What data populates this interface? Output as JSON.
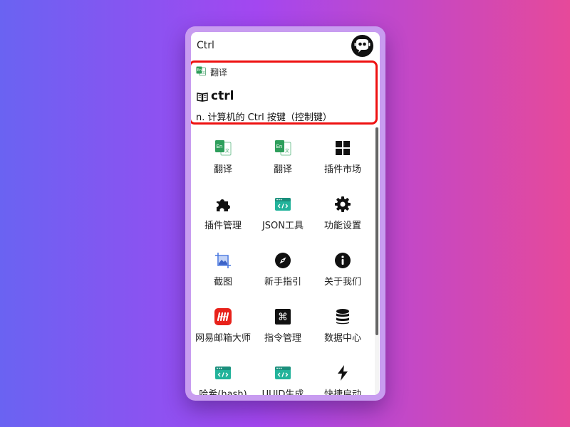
{
  "search": {
    "value": "Ctrl"
  },
  "result": {
    "plugin_label": "翻译",
    "word": "ctrl",
    "definition": "n. 计算机的 Ctrl 按键（控制键）"
  },
  "apps": [
    {
      "label": "翻译",
      "icon": "translate-icon"
    },
    {
      "label": "翻译",
      "icon": "translate-icon"
    },
    {
      "label": "插件市场",
      "icon": "windows-grid-icon"
    },
    {
      "label": "插件管理",
      "icon": "puzzle-icon"
    },
    {
      "label": "JSON工具",
      "icon": "code-window-icon"
    },
    {
      "label": "功能设置",
      "icon": "gear-icon"
    },
    {
      "label": "截图",
      "icon": "screenshot-icon"
    },
    {
      "label": "新手指引",
      "icon": "compass-icon"
    },
    {
      "label": "关于我们",
      "icon": "info-icon"
    },
    {
      "label": "网易邮箱大师",
      "icon": "netease-mail-icon"
    },
    {
      "label": "指令管理",
      "icon": "command-key-icon"
    },
    {
      "label": "数据中心",
      "icon": "database-icon"
    },
    {
      "label": "哈希(hash)",
      "icon": "code-window-icon"
    },
    {
      "label": "UUID生成",
      "icon": "code-window-icon"
    },
    {
      "label": "快捷启动",
      "icon": "lightning-icon"
    }
  ],
  "colors": {
    "highlight_border": "#ee1111",
    "translate_green": "#2e9e5b",
    "code_teal": "#22b39b",
    "netease_red": "#e8221b"
  }
}
